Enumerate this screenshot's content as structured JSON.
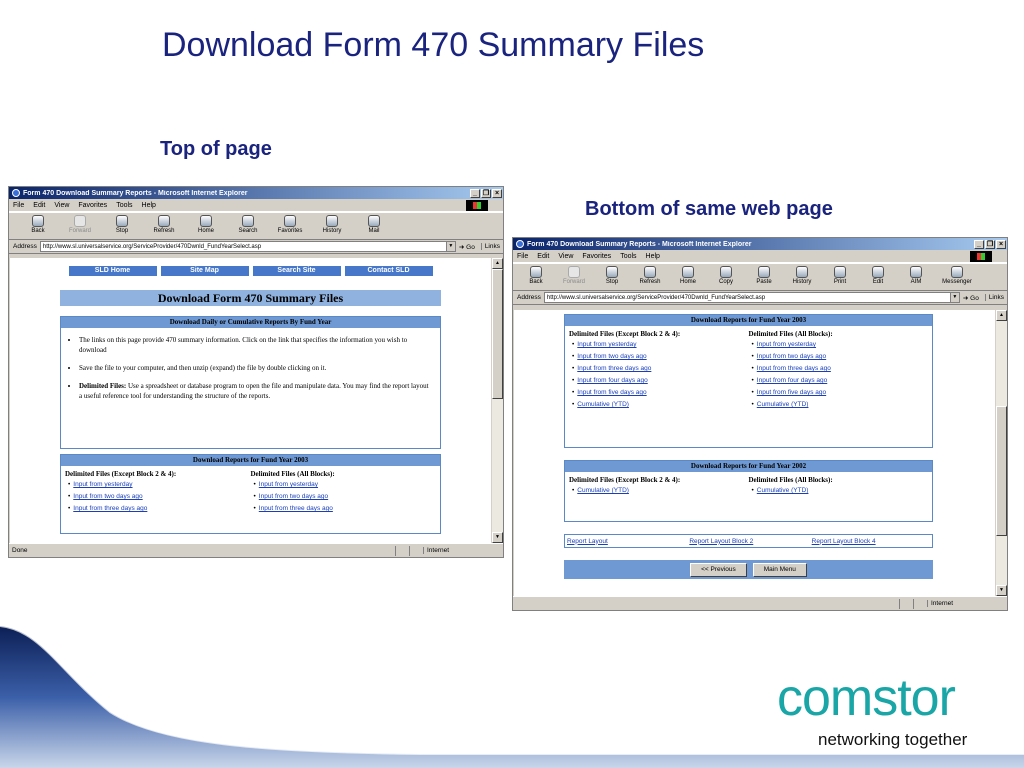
{
  "slide": {
    "title": "Download Form 470 Summary Files",
    "caption_top": "Top of page",
    "caption_bottom": "Bottom of same web page"
  },
  "browser": {
    "title": "Form 470 Download Summary Reports - Microsoft Internet Explorer",
    "menu": [
      "File",
      "Edit",
      "View",
      "Favorites",
      "Tools",
      "Help"
    ],
    "toolbar_a": [
      "Back",
      "Forward",
      "Stop",
      "Refresh",
      "Home",
      "Search",
      "Favorites",
      "History",
      "Mail"
    ],
    "toolbar_b": [
      "Back",
      "Forward",
      "Stop",
      "Refresh",
      "Home",
      "Copy",
      "Paste",
      "History",
      "Print",
      "Edit",
      "AIM",
      "Messenger"
    ],
    "address_label": "Address",
    "address_value": "http://www.sl.universalservice.org/ServiceProvider/470Dwnld_FundYearSelect.asp",
    "go_label": "Go",
    "links_label": "Links",
    "status_a": "Done",
    "zone": "Internet"
  },
  "page": {
    "nav": [
      "SLD Home",
      "Site Map",
      "Search Site",
      "Contact SLD"
    ],
    "heading": "Download Form 470 Summary Files",
    "daily_box_title": "Download Daily or Cumulative Reports By Fund Year",
    "bullets": [
      "The links on this page provide 470 summary information. Click on the link that specifies the information you wish to download",
      "Save the file to your computer, and then unzip (expand) the file by double clicking on it."
    ],
    "delimited_label": "Delimited Files:",
    "delimited_text": " Use a spreadsheet or database program to open the file and manipulate data. You may find the report layout a useful reference tool for understanding the structure of the reports.",
    "fy2003_title": "Download Reports for Fund  Year 2003",
    "fy2002_title": "Download Reports for Fund  Year 2002",
    "col_left": "Delimited Files (Except Block 2 & 4):",
    "col_right": "Delimited Files (All Blocks):",
    "links": [
      "Input from yesterday",
      "Input from two days ago",
      "Input from three days ago",
      "Input from four days ago",
      "Input from five days ago",
      "Cumulative (YTD)"
    ],
    "report_links": [
      "Report Layout",
      "Report Layout Block 2",
      "Report Layout Block 4"
    ],
    "previous_button": "<< Previous",
    "main_menu_button": "Main Menu"
  },
  "footer": {
    "logo": "comstor",
    "tagline": "networking together",
    "logo_color": "#1aa6a6",
    "swoosh_color": "#1a3a7a"
  }
}
